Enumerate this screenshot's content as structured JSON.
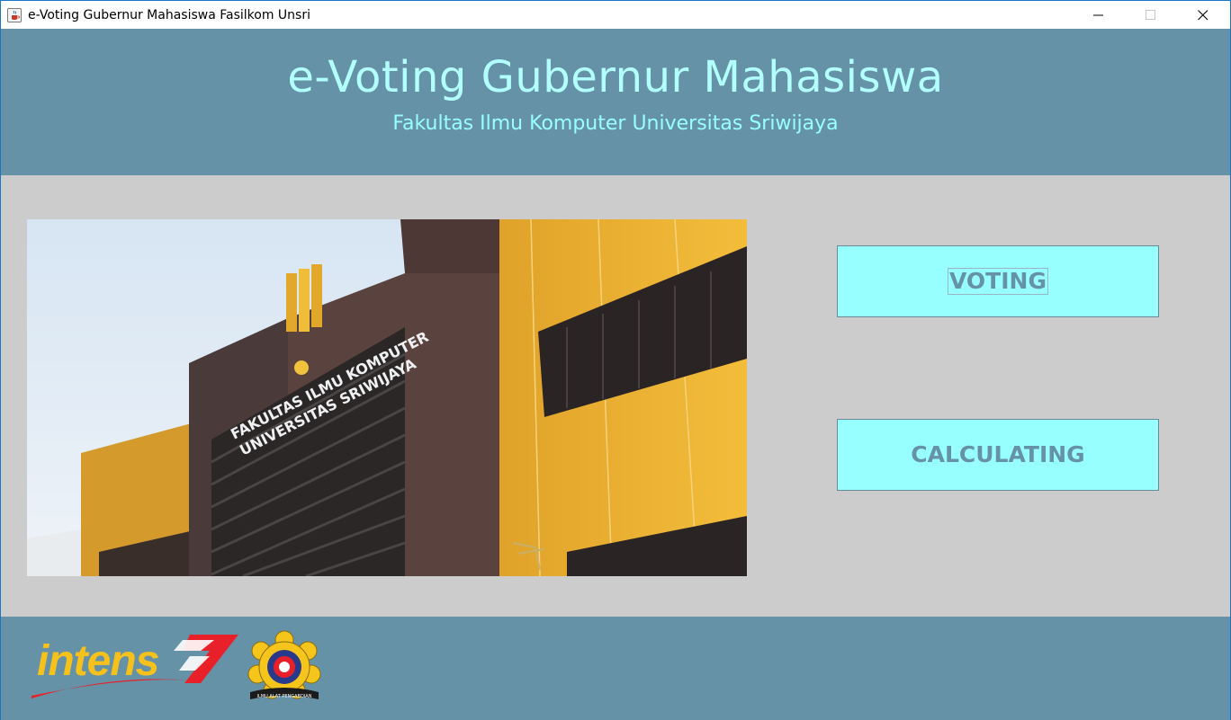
{
  "window": {
    "title": "e-Voting Gubernur Mahasiswa Fasilkom Unsri",
    "icon": "java-cup-icon",
    "controls": [
      "minimize-icon",
      "maximize-icon",
      "close-icon"
    ]
  },
  "header": {
    "title": "e-Voting Gubernur Mahasiswa",
    "subtitle": "Fakultas Ilmu Komputer Universitas Sriwijaya"
  },
  "main": {
    "photo": {
      "building_sign_line1": "FAKULTAS ILMU KOMPUTER",
      "building_sign_line2": "UNIVERSITAS SRIWIJAYA"
    },
    "buttons": {
      "voting_label": "VOTING",
      "calculating_label": "CALCULATING"
    }
  },
  "footer": {
    "intens_logo_text": "intens",
    "unsri_logo_ribbon": "ILMU ALAT PENGABDIAN"
  },
  "colors": {
    "header_bg": "#6692a7",
    "header_title": "#b2ffff",
    "header_subtitle": "#98ffff",
    "main_bg": "#cccccc",
    "button_bg": "#98ffff",
    "button_text": "#6692a7",
    "intens_yellow": "#f5c11a",
    "intens_red": "#e8202a"
  }
}
